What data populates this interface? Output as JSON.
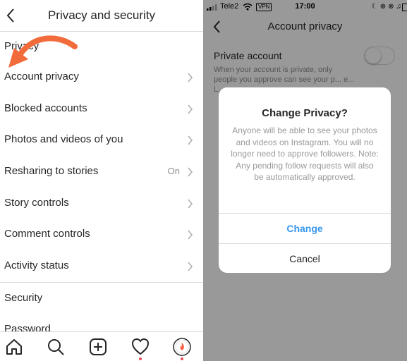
{
  "left": {
    "title": "Privacy and security",
    "section_privacy": "Privacy",
    "items": [
      {
        "label": "Account privacy",
        "value": ""
      },
      {
        "label": "Blocked accounts",
        "value": ""
      },
      {
        "label": "Photos and videos of you",
        "value": ""
      },
      {
        "label": "Resharing to stories",
        "value": "On"
      },
      {
        "label": "Story controls",
        "value": ""
      },
      {
        "label": "Comment controls",
        "value": ""
      },
      {
        "label": "Activity status",
        "value": ""
      }
    ],
    "section_security": "Security",
    "password_label": "Password",
    "nav": [
      "home-icon",
      "search-icon",
      "new-post-icon",
      "activity-heart-icon",
      "profile-avatar"
    ],
    "arrow_color": "#f26b3a"
  },
  "right": {
    "status": {
      "carrier": "Tele2",
      "vpn": "VPN",
      "time": "17:00"
    },
    "title": "Account privacy",
    "private_account_label": "Private account",
    "private_account_desc": "When your account is private, only people you approve can see your p... e... L...",
    "private_account_on": false,
    "dialog": {
      "title": "Change Privacy?",
      "body": "Anyone will be able to see your photos and videos on Instagram. You will no longer need to approve followers. Note: Any pending follow requests will also be automatically approved.",
      "confirm": "Change",
      "cancel": "Cancel"
    }
  }
}
